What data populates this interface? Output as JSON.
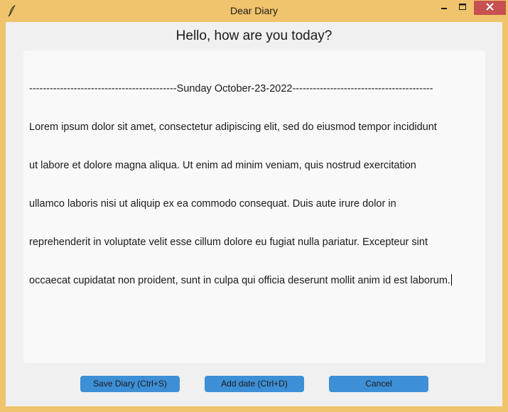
{
  "window": {
    "title": "Dear Diary",
    "frame_color": "#f0c46c",
    "close_color": "#c75050"
  },
  "main": {
    "greeting": "Hello, how are you today?",
    "editor": {
      "date_line": "-------------------------------------------Sunday October-23-2022-----------------------------------------",
      "body_lines": [
        "Lorem ipsum dolor sit amet, consectetur adipiscing elit, sed do eiusmod tempor incididunt",
        "ut labore et dolore magna aliqua. Ut enim ad minim veniam, quis nostrud exercitation",
        "ullamco laboris nisi ut aliquip ex ea commodo consequat. Duis aute irure dolor in",
        "reprehenderit in voluptate velit esse cillum dolore eu fugiat nulla pariatur. Excepteur sint",
        "occaecat cupidatat non proident, sunt in culpa qui officia deserunt mollit anim id est laborum."
      ]
    }
  },
  "buttons": {
    "save_label": "Save Diary (Ctrl+S)",
    "add_date_label": "Add date (Ctrl+D)",
    "cancel_label": "Cancel",
    "accent": "#3d8fd6"
  },
  "icons": {
    "app": "feather-icon",
    "minimize": "minimize-icon",
    "maximize": "maximize-icon",
    "close": "close-icon"
  }
}
